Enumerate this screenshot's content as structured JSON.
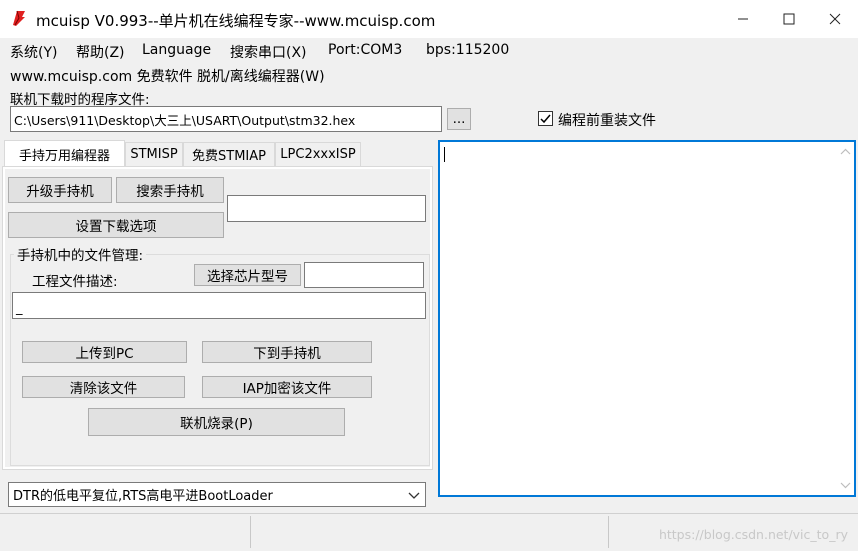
{
  "window": {
    "title": "mcuisp V0.993--单片机在线编程专家--www.mcuisp.com",
    "minimize": "—",
    "maximize": "☐",
    "close": "✕"
  },
  "menu": {
    "items": [
      "系统(Y)",
      "帮助(Z)",
      "Language",
      "搜索串口(X)",
      "Port:COM3",
      "bps:115200"
    ],
    "second_line": "www.mcuisp.com 免费软件 脱机/离线编程器(W)"
  },
  "file_section": {
    "label": "联机下载时的程序文件:",
    "path": "C:\\Users\\911\\Desktop\\大三上\\USART\\Output\\stm32.hex",
    "browse_button": "...",
    "reload_checkbox_label": "编程前重装文件",
    "reload_checked": true
  },
  "tabs": [
    "手持万用编程器",
    "STMISP",
    "免费STMIAP",
    "LPC2xxxISP"
  ],
  "handheld": {
    "upgrade_button": "升级手持机",
    "search_button": "搜索手持机",
    "settings_button": "设置下载选项",
    "group_title": "手持机中的文件管理:",
    "project_desc_label": "工程文件描述:",
    "select_chip_button": "选择芯片型号",
    "desc_value": "_",
    "upload_button": "上传到PC",
    "download_button": "下到手持机",
    "clear_button": "清除该文件",
    "iap_button": "IAP加密该文件",
    "online_burn_button": "联机烧录(P)"
  },
  "reset_mode": {
    "selected": "DTR的低电平复位,RTS高电平进BootLoader"
  },
  "colors": {
    "focus_border": "#0078d7",
    "app_icon_red": "#e02020"
  },
  "watermark": "https://blog.csdn.net/vic_to_ry"
}
